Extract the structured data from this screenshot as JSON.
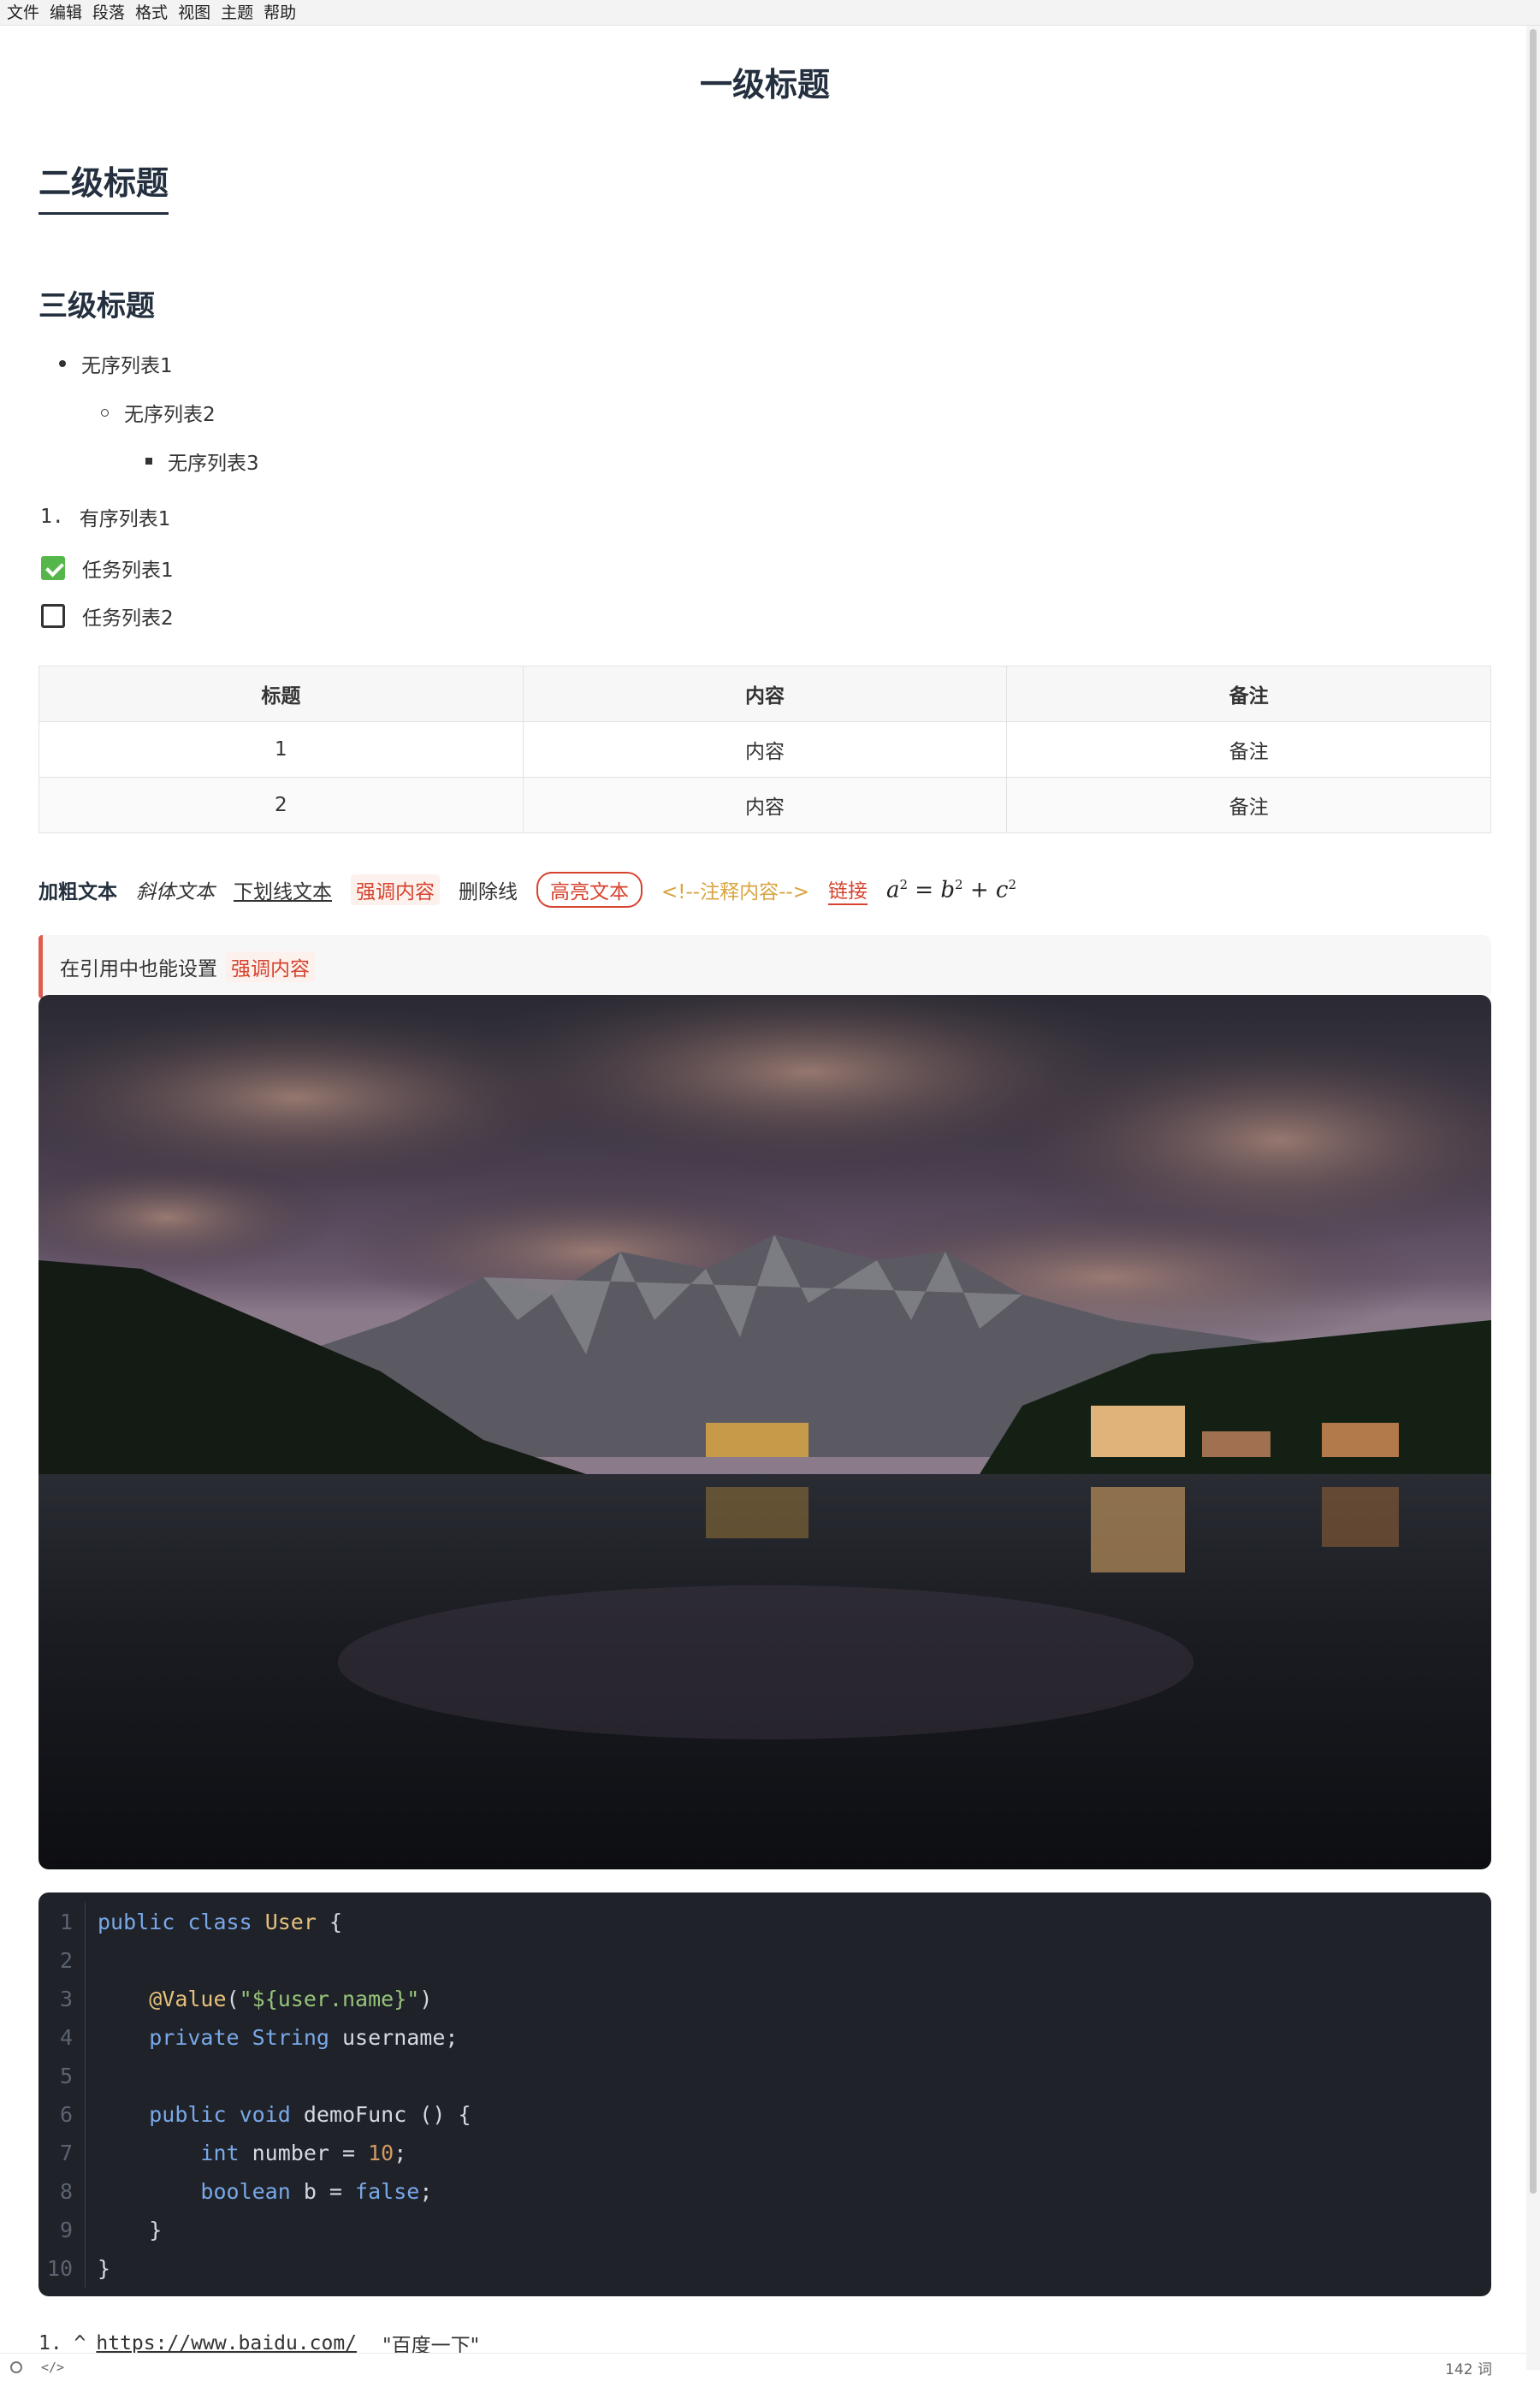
{
  "menu": [
    "文件",
    "编辑",
    "段落",
    "格式",
    "视图",
    "主题",
    "帮助"
  ],
  "doc": {
    "h1": "一级标题",
    "h2": "二级标题",
    "h3": "三级标题",
    "ul": [
      "无序列表1",
      "无序列表2",
      "无序列表3"
    ],
    "ol": {
      "num": "1.",
      "text": "有序列表1"
    },
    "tasks": [
      {
        "text": "任务列表1",
        "checked": true
      },
      {
        "text": "任务列表2",
        "checked": false
      }
    ],
    "table": {
      "headers": [
        "标题",
        "内容",
        "备注"
      ],
      "rows": [
        [
          "1",
          "内容",
          "备注"
        ],
        [
          "2",
          "内容",
          "备注"
        ]
      ]
    },
    "inline": {
      "bold": "加粗文本",
      "italic": "斜体文本",
      "underline": "下划线文本",
      "emphasis": "强调内容",
      "strike": "删除线",
      "highlight": "高亮文本",
      "comment": "<!--注释内容-->",
      "link": "链接",
      "math": {
        "a": "a",
        "b": "b",
        "c": "c",
        "exp": "2",
        "eq": " = ",
        "plus": " + "
      }
    },
    "quote": {
      "text": "在引用中也能设置",
      "emphasis": "强调内容"
    },
    "code": [
      {
        "n": "1"
      },
      {
        "n": "2"
      },
      {
        "n": "3"
      },
      {
        "n": "4"
      },
      {
        "n": "5"
      },
      {
        "n": "6"
      },
      {
        "n": "7"
      },
      {
        "n": "8"
      },
      {
        "n": "9"
      },
      {
        "n": "10"
      }
    ],
    "code_text": {
      "l1_kw": "public class",
      "l1_cls": "User",
      "l1_rest": " {",
      "l3_ann": "@Value",
      "l3_open": "(",
      "l3_str": "\"${user.name}\"",
      "l3_close": ")",
      "l4_kw": "private",
      "l4_cls": "String",
      "l4_rest": " username;",
      "l6_kw": "public void",
      "l6_rest": " demoFunc () {",
      "l7_kw": "int",
      "l7_mid": " number = ",
      "l7_num": "10",
      "l7_end": ";",
      "l8_kw": "boolean",
      "l8_mid": " b = ",
      "l8_bool": "false",
      "l8_end": ";",
      "l9": "}",
      "l10": "}"
    },
    "footnote": {
      "prefix": "1. ^",
      "url": "https://www.baidu.com/",
      "title": "\"百度一下\""
    }
  },
  "status": {
    "code_toggle": "</>",
    "words": "142 词"
  }
}
